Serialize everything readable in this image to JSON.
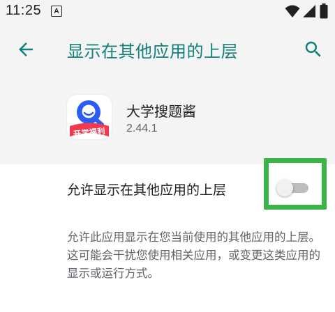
{
  "status_bar": {
    "time": "11:25",
    "notification_icon": "a-square-icon",
    "notification_letter": "A",
    "icons": [
      "wifi-icon",
      "signal-icon",
      "battery-icon"
    ]
  },
  "app_bar": {
    "back_icon": "arrow-back-icon",
    "title": "显示在其他应用的上层",
    "search_icon": "search-icon",
    "accent_color": "#12807a"
  },
  "app": {
    "name": "大学搜题酱",
    "version": "2.44.1",
    "icon_badge_text": "开学福利"
  },
  "permission": {
    "label": "允许显示在其他应用的上层",
    "enabled": false,
    "description": "允许此应用显示在您当前使用的其他应用的上层。这可能会干扰您使用相关应用，或变更这类应用的显示或运行方式。",
    "highlight_color": "#3bb34a"
  }
}
